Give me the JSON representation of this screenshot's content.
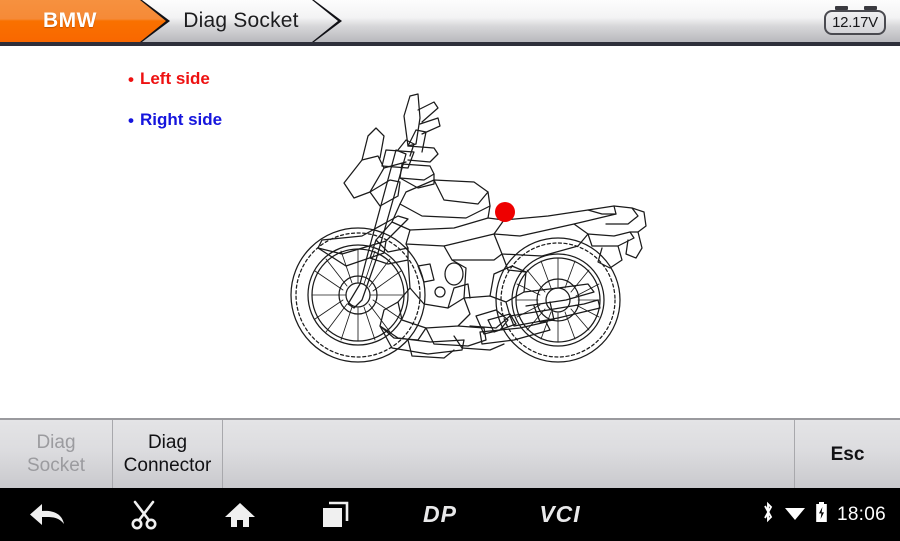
{
  "header": {
    "brand_tab": "BMW",
    "section_tab": "Diag Socket",
    "battery_voltage": "12.17V",
    "accent_color": "#f97100"
  },
  "content": {
    "legend": [
      {
        "bullet": "•",
        "label": "Left side",
        "color": "#ee1111"
      },
      {
        "bullet": "•",
        "label": "Right side",
        "color": "#1515dd"
      }
    ],
    "illustration": {
      "name": "motorcycle-side-view",
      "marker_color": "#ee0000",
      "marker_side": "Left side"
    }
  },
  "buttonbar": {
    "diag_socket": "Diag\nSocket",
    "diag_socket_line1": "Diag",
    "diag_socket_line2": "Socket",
    "diag_connector_line1": "Diag",
    "diag_connector_line2": "Connector",
    "esc": "Esc"
  },
  "navbar": {
    "icons": [
      "back-icon",
      "scissors-icon",
      "home-icon",
      "recent-apps-icon"
    ],
    "dp_logo": "DP",
    "vci_logo": "VCI",
    "status": [
      "bluetooth-icon",
      "wifi-icon",
      "battery-charging-icon"
    ],
    "clock": "18:06"
  }
}
